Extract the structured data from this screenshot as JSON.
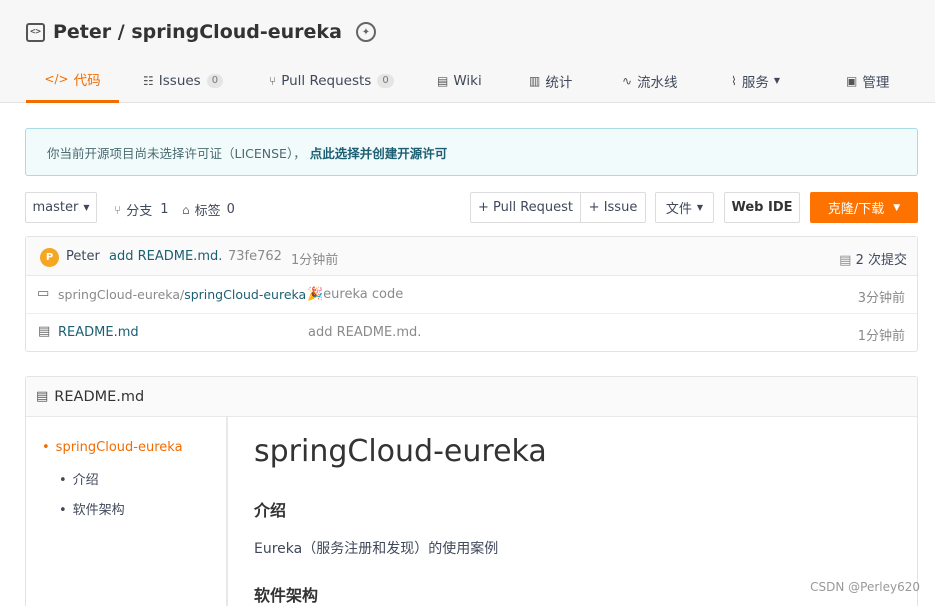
{
  "repo": {
    "title": "Peter / springCloud-eureka"
  },
  "tabs": [
    {
      "label": "代码",
      "icon": "code-icon"
    },
    {
      "label": "Issues",
      "count": "0",
      "icon": "issues-icon"
    },
    {
      "label": "Pull Requests",
      "count": "0",
      "icon": "pull-request-icon"
    },
    {
      "label": "Wiki",
      "icon": "wiki-icon"
    },
    {
      "label": "统计",
      "icon": "chart-icon"
    },
    {
      "label": "流水线",
      "icon": "pipeline-icon"
    },
    {
      "label": "服务",
      "icon": "pulse-icon"
    },
    {
      "label": "管理",
      "icon": "settings-doc-icon"
    }
  ],
  "notice": {
    "text": "你当前开源项目尚未选择许可证（LICENSE），",
    "link": "点此选择并创建开源许可"
  },
  "toolbar": {
    "branch": "master",
    "branches_label": "分支",
    "branches_count": "1",
    "tags_label": "标签",
    "tags_count": "0",
    "pull_request_btn": "+ Pull Request",
    "issue_btn": "+ Issue",
    "file_btn": "文件",
    "webide_btn": "Web IDE",
    "clone_btn": "克隆/下载"
  },
  "commit": {
    "avatar": "P",
    "author": "Peter",
    "message": "add README.md.",
    "hash": "73fe762",
    "time": "1分钟前",
    "commits": "2 次提交"
  },
  "files": [
    {
      "path_prefix": "springCloud-eureka/",
      "name": "springCloud-eureka",
      "message": "🎉eureka code",
      "time": "3分钟前"
    },
    {
      "name": "README.md",
      "message": "add README.md.",
      "time": "1分钟前"
    }
  ],
  "readme": {
    "header": "README.md",
    "toc": [
      "springCloud-eureka",
      "介绍",
      "软件架构"
    ],
    "title": "springCloud-eureka",
    "h_intro": "介绍",
    "intro_text": "Eureka（服务注册和发现）的使用案例",
    "h_arch": "软件架构"
  },
  "watermark": "CSDN @Perley620",
  "colors": {
    "accent": "#f36c00",
    "link": "#1c5f73"
  }
}
